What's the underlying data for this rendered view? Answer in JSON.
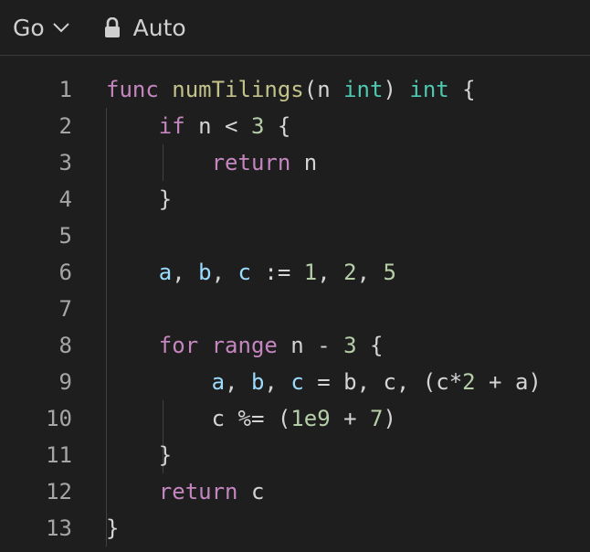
{
  "toolbar": {
    "language": "Go",
    "mode": "Auto",
    "icons": {
      "language_dropdown": "chevron-down-icon",
      "mode": "lock-icon"
    }
  },
  "editor": {
    "lines": [
      {
        "number": "1",
        "tokens": [
          [
            "kw",
            "func"
          ],
          [
            "p",
            " "
          ],
          [
            "fn",
            "numTilings"
          ],
          [
            "p",
            "(n "
          ],
          [
            "ty",
            "int"
          ],
          [
            "p",
            ") "
          ],
          [
            "ty",
            "int"
          ],
          [
            "p",
            " {"
          ]
        ]
      },
      {
        "number": "2",
        "tokens": [
          [
            "p",
            "    "
          ],
          [
            "kw",
            "if"
          ],
          [
            "p",
            " n < "
          ],
          [
            "num",
            "3"
          ],
          [
            "p",
            " {"
          ]
        ]
      },
      {
        "number": "3",
        "tokens": [
          [
            "p",
            "        "
          ],
          [
            "kw",
            "return"
          ],
          [
            "p",
            " n"
          ]
        ]
      },
      {
        "number": "4",
        "tokens": [
          [
            "p",
            "    }"
          ]
        ]
      },
      {
        "number": "5",
        "tokens": []
      },
      {
        "number": "6",
        "tokens": [
          [
            "p",
            "    "
          ],
          [
            "var",
            "a"
          ],
          [
            "p",
            ", "
          ],
          [
            "var",
            "b"
          ],
          [
            "p",
            ", "
          ],
          [
            "var",
            "c"
          ],
          [
            "p",
            " := "
          ],
          [
            "num",
            "1"
          ],
          [
            "p",
            ", "
          ],
          [
            "num",
            "2"
          ],
          [
            "p",
            ", "
          ],
          [
            "num",
            "5"
          ]
        ]
      },
      {
        "number": "7",
        "tokens": []
      },
      {
        "number": "8",
        "tokens": [
          [
            "p",
            "    "
          ],
          [
            "kw",
            "for"
          ],
          [
            "p",
            " "
          ],
          [
            "kw",
            "range"
          ],
          [
            "p",
            " n - "
          ],
          [
            "num",
            "3"
          ],
          [
            "p",
            " {"
          ]
        ]
      },
      {
        "number": "9",
        "tokens": [
          [
            "p",
            "        "
          ],
          [
            "var",
            "a"
          ],
          [
            "p",
            ", "
          ],
          [
            "var",
            "b"
          ],
          [
            "p",
            ", "
          ],
          [
            "var",
            "c"
          ],
          [
            "p",
            " = b, c, (c*"
          ],
          [
            "num",
            "2"
          ],
          [
            "p",
            " + a)"
          ]
        ]
      },
      {
        "number": "10",
        "tokens": [
          [
            "p",
            "        c %= ("
          ],
          [
            "num",
            "1e9"
          ],
          [
            "p",
            " + "
          ],
          [
            "num",
            "7"
          ],
          [
            "p",
            ")"
          ]
        ]
      },
      {
        "number": "11",
        "tokens": [
          [
            "p",
            "    }"
          ]
        ]
      },
      {
        "number": "12",
        "tokens": [
          [
            "p",
            "    "
          ],
          [
            "kw",
            "return"
          ],
          [
            "p",
            " c"
          ]
        ]
      },
      {
        "number": "13",
        "tokens": [
          [
            "p",
            "}"
          ]
        ]
      }
    ]
  },
  "colors": {
    "background": "#1e1e1e",
    "keyword": "#c586c0",
    "function": "#c2c28a",
    "type": "#4ec9b0",
    "number": "#b5cea8",
    "variable": "#9cdcfe",
    "text": "#d4d4d4",
    "line_number": "#a6a6a6"
  }
}
